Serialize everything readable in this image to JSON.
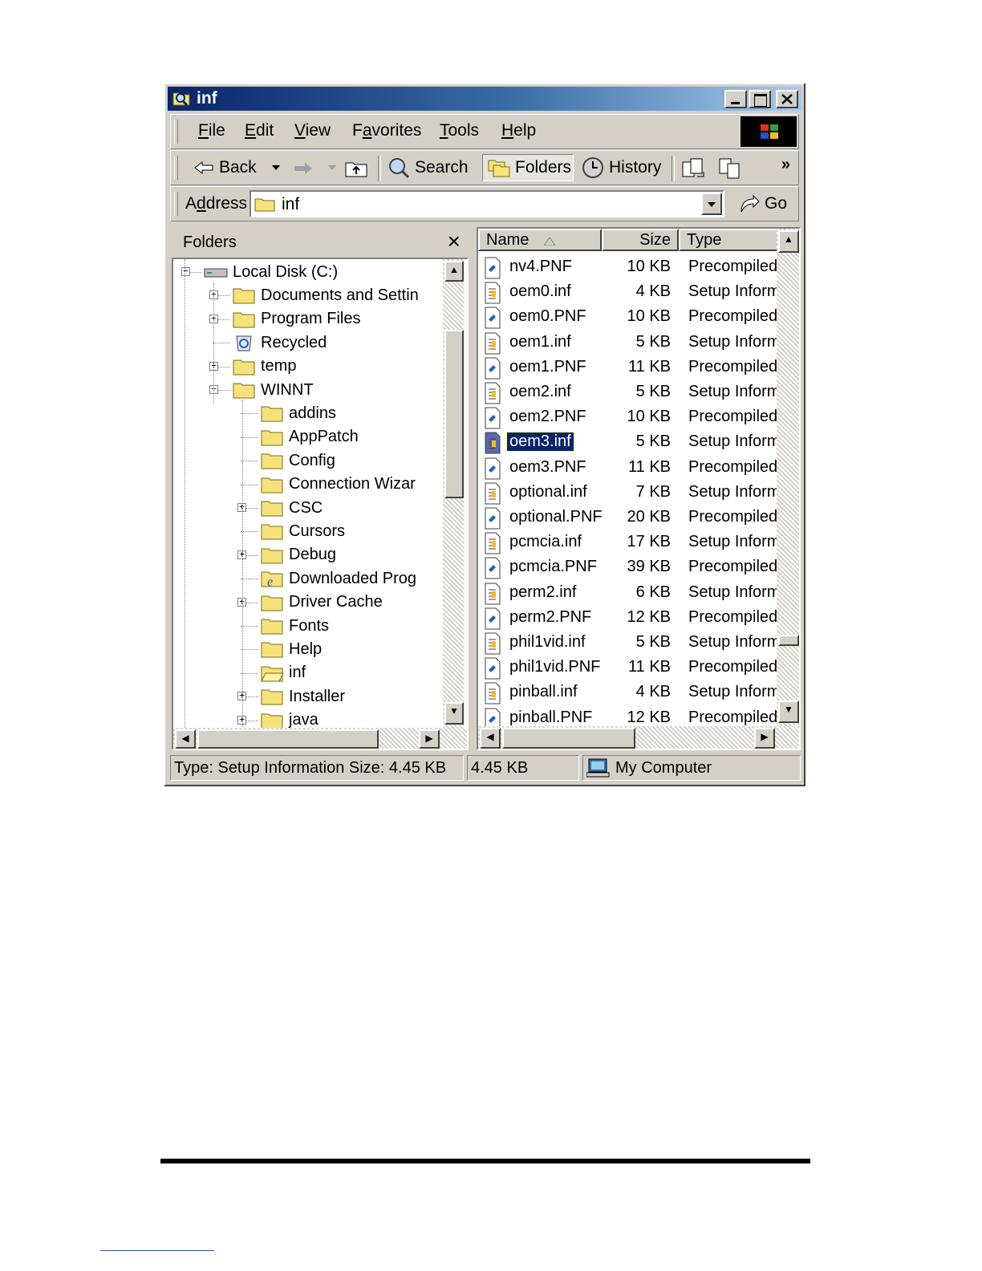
{
  "window": {
    "title": "inf"
  },
  "menu": [
    {
      "label_pre": "",
      "accel": "F",
      "label_post": "ile"
    },
    {
      "label_pre": "",
      "accel": "E",
      "label_post": "dit"
    },
    {
      "label_pre": "",
      "accel": "V",
      "label_post": "iew"
    },
    {
      "label_pre": "F",
      "accel": "a",
      "label_post": "vorites"
    },
    {
      "label_pre": "",
      "accel": "T",
      "label_post": "ools"
    },
    {
      "label_pre": "",
      "accel": "H",
      "label_post": "elp"
    }
  ],
  "toolbar": {
    "back": "Back",
    "search": "Search",
    "folders": "Folders",
    "history": "History",
    "more": "»"
  },
  "address": {
    "label_pre": "A",
    "accel": "d",
    "label_post": "dress",
    "value": "inf",
    "go": "Go"
  },
  "folders_pane": {
    "title": "Folders",
    "close": "×"
  },
  "tree": [
    {
      "label": "Local Disk (C:)",
      "depth": 0,
      "icon": "drive-icon",
      "expander": "minus"
    },
    {
      "label": "Documents and Settin",
      "depth": 1,
      "icon": "folder-icon",
      "expander": "plus"
    },
    {
      "label": "Program Files",
      "depth": 1,
      "icon": "folder-icon",
      "expander": "plus"
    },
    {
      "label": "Recycled",
      "depth": 1,
      "icon": "recycle-bin-icon",
      "expander": "none"
    },
    {
      "label": "temp",
      "depth": 1,
      "icon": "folder-icon",
      "expander": "plus"
    },
    {
      "label": "WINNT",
      "depth": 1,
      "icon": "folder-icon",
      "expander": "minus"
    },
    {
      "label": "addins",
      "depth": 2,
      "icon": "folder-icon",
      "expander": "none"
    },
    {
      "label": "AppPatch",
      "depth": 2,
      "icon": "folder-icon",
      "expander": "none"
    },
    {
      "label": "Config",
      "depth": 2,
      "icon": "folder-icon",
      "expander": "none"
    },
    {
      "label": "Connection Wizar",
      "depth": 2,
      "icon": "folder-icon",
      "expander": "none"
    },
    {
      "label": "CSC",
      "depth": 2,
      "icon": "folder-icon",
      "expander": "plus"
    },
    {
      "label": "Cursors",
      "depth": 2,
      "icon": "folder-icon",
      "expander": "none"
    },
    {
      "label": "Debug",
      "depth": 2,
      "icon": "folder-icon",
      "expander": "plus"
    },
    {
      "label": "Downloaded Prog",
      "depth": 2,
      "icon": "ie-folder-icon",
      "expander": "none"
    },
    {
      "label": "Driver Cache",
      "depth": 2,
      "icon": "folder-icon",
      "expander": "plus"
    },
    {
      "label": "Fonts",
      "depth": 2,
      "icon": "folder-icon",
      "expander": "none"
    },
    {
      "label": "Help",
      "depth": 2,
      "icon": "folder-icon",
      "expander": "none"
    },
    {
      "label": "inf",
      "depth": 2,
      "icon": "open-folder-icon",
      "expander": "none"
    },
    {
      "label": "Installer",
      "depth": 2,
      "icon": "folder-icon",
      "expander": "plus"
    },
    {
      "label": "java",
      "depth": 2,
      "icon": "folder-icon",
      "expander": "plus"
    }
  ],
  "columns": {
    "name": "Name",
    "size": "Size",
    "type": "Type"
  },
  "files": [
    {
      "name": "nv4.PNF",
      "size": "10 KB",
      "type": "Precompiled",
      "kind": "pnf"
    },
    {
      "name": "oem0.inf",
      "size": "4 KB",
      "type": "Setup Inform",
      "kind": "inf"
    },
    {
      "name": "oem0.PNF",
      "size": "10 KB",
      "type": "Precompiled",
      "kind": "pnf"
    },
    {
      "name": "oem1.inf",
      "size": "5 KB",
      "type": "Setup Inform",
      "kind": "inf"
    },
    {
      "name": "oem1.PNF",
      "size": "11 KB",
      "type": "Precompiled",
      "kind": "pnf"
    },
    {
      "name": "oem2.inf",
      "size": "5 KB",
      "type": "Setup Inform",
      "kind": "inf"
    },
    {
      "name": "oem2.PNF",
      "size": "10 KB",
      "type": "Precompiled",
      "kind": "pnf"
    },
    {
      "name": "oem3.inf",
      "size": "5 KB",
      "type": "Setup Inform",
      "kind": "inf",
      "selected": true
    },
    {
      "name": "oem3.PNF",
      "size": "11 KB",
      "type": "Precompiled",
      "kind": "pnf"
    },
    {
      "name": "optional.inf",
      "size": "7 KB",
      "type": "Setup Inform",
      "kind": "inf"
    },
    {
      "name": "optional.PNF",
      "size": "20 KB",
      "type": "Precompiled",
      "kind": "pnf"
    },
    {
      "name": "pcmcia.inf",
      "size": "17 KB",
      "type": "Setup Inform",
      "kind": "inf"
    },
    {
      "name": "pcmcia.PNF",
      "size": "39 KB",
      "type": "Precompiled",
      "kind": "pnf"
    },
    {
      "name": "perm2.inf",
      "size": "6 KB",
      "type": "Setup Inform",
      "kind": "inf"
    },
    {
      "name": "perm2.PNF",
      "size": "12 KB",
      "type": "Precompiled",
      "kind": "pnf"
    },
    {
      "name": "phil1vid.inf",
      "size": "5 KB",
      "type": "Setup Inform",
      "kind": "inf"
    },
    {
      "name": "phil1vid.PNF",
      "size": "11 KB",
      "type": "Precompiled",
      "kind": "pnf"
    },
    {
      "name": "pinball.inf",
      "size": "4 KB",
      "type": "Setup Inform",
      "kind": "inf"
    },
    {
      "name": "pinball.PNF",
      "size": "12 KB",
      "type": "Precompiled",
      "kind": "pnf"
    }
  ],
  "status": {
    "info": "Type: Setup Information Size: 4.45 KB",
    "size": "4.45 KB",
    "zone": "My Computer"
  },
  "colors": {
    "title_start": "#0a246a",
    "title_end": "#a6caf0",
    "face": "#d4d0c8",
    "selection": "#0a246a"
  }
}
